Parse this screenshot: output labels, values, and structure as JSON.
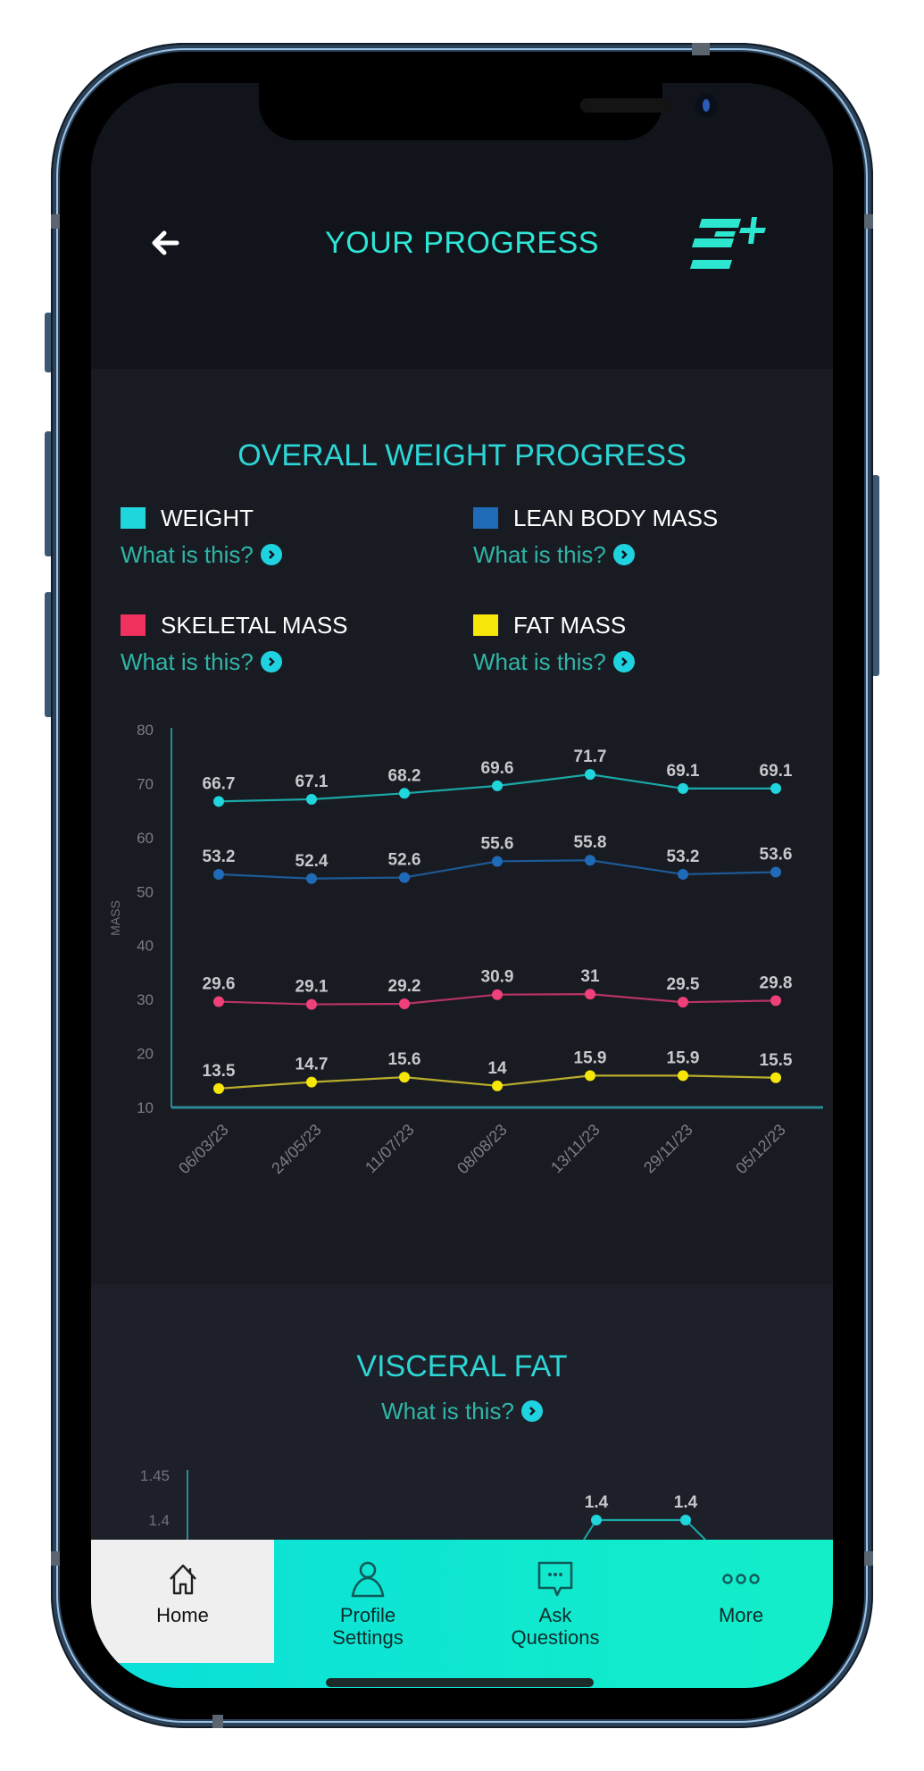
{
  "header": {
    "title": "YOUR PROGRESS",
    "back_icon": "arrow-left-icon",
    "logo_icon": "brand-logo-icon"
  },
  "weight_section": {
    "title": "OVERALL WEIGHT PROGRESS",
    "legend": [
      {
        "label": "WEIGHT",
        "color": "#1fd6dc",
        "link": "What is this?"
      },
      {
        "label": "LEAN BODY MASS",
        "color": "#1f6bb8",
        "link": "What is this?"
      },
      {
        "label": "SKELETAL MASS",
        "color": "#f0305f",
        "link": "What is this?"
      },
      {
        "label": "FAT MASS",
        "color": "#f6e60a",
        "link": "What is this?"
      }
    ]
  },
  "visceral_section": {
    "title": "VISCERAL FAT",
    "link": "What is this?"
  },
  "chart_data": [
    {
      "type": "line",
      "title": "OVERALL WEIGHT PROGRESS",
      "xlabel": "",
      "ylabel": "MASS",
      "ylim": [
        10,
        80
      ],
      "yticks": [
        "10",
        "20",
        "30",
        "40",
        "50",
        "60",
        "70",
        "80"
      ],
      "grid": false,
      "legend_position": "top",
      "x": [
        "06/03/23",
        "24/05/23",
        "11/07/23",
        "08/08/23",
        "13/11/23",
        "29/11/23",
        "05/12/23"
      ],
      "series": [
        {
          "name": "WEIGHT",
          "color": "#1fd6dc",
          "line_color": "#1aa9a8",
          "values": [
            66.7,
            67.1,
            68.2,
            69.6,
            71.7,
            69.1,
            69.1
          ],
          "labels": [
            "66.7",
            "67.1",
            "68.2",
            "69.6",
            "71.7",
            "69.1",
            "69.1"
          ]
        },
        {
          "name": "LEAN BODY MASS",
          "color": "#1f6bb8",
          "line_color": "#1d5a96",
          "values": [
            53.2,
            52.4,
            52.6,
            55.6,
            55.8,
            53.2,
            53.6
          ],
          "labels": [
            "53.2",
            "52.4",
            "52.6",
            "55.6",
            "55.8",
            "53.2",
            "53.6"
          ]
        },
        {
          "name": "SKELETAL MASS",
          "color": "#f0407a",
          "line_color": "#b83363",
          "values": [
            29.6,
            29.1,
            29.2,
            30.9,
            31,
            29.5,
            29.8
          ],
          "labels": [
            "29.6",
            "29.1",
            "29.2",
            "30.9",
            "31",
            "29.5",
            "29.8"
          ]
        },
        {
          "name": "FAT MASS",
          "color": "#f6e60a",
          "line_color": "#b9ad2c",
          "values": [
            13.5,
            14.7,
            15.6,
            14,
            15.9,
            15.9,
            15.5
          ],
          "labels": [
            "13.5",
            "14.7",
            "15.6",
            "14",
            "15.9",
            "15.9",
            "15.5"
          ]
        }
      ]
    },
    {
      "type": "line",
      "title": "VISCERAL FAT",
      "ylim_visible": [
        1.4,
        1.45
      ],
      "yticks": [
        "1.4",
        "1.45"
      ],
      "grid": false,
      "visible_points": [
        {
          "value": 1.4,
          "label": "1.4"
        },
        {
          "value": 1.4,
          "label": "1.4"
        }
      ],
      "color": "#1fd6dc"
    }
  ],
  "tabbar": {
    "items": [
      {
        "label": "Home",
        "icon": "home-icon",
        "active": true
      },
      {
        "label": "Profile\nSettings",
        "icon": "user-icon",
        "active": false
      },
      {
        "label": "Ask\nQuestions",
        "icon": "chat-bubble-icon",
        "active": false
      },
      {
        "label": "More",
        "icon": "more-dots-icon",
        "active": false
      }
    ]
  }
}
